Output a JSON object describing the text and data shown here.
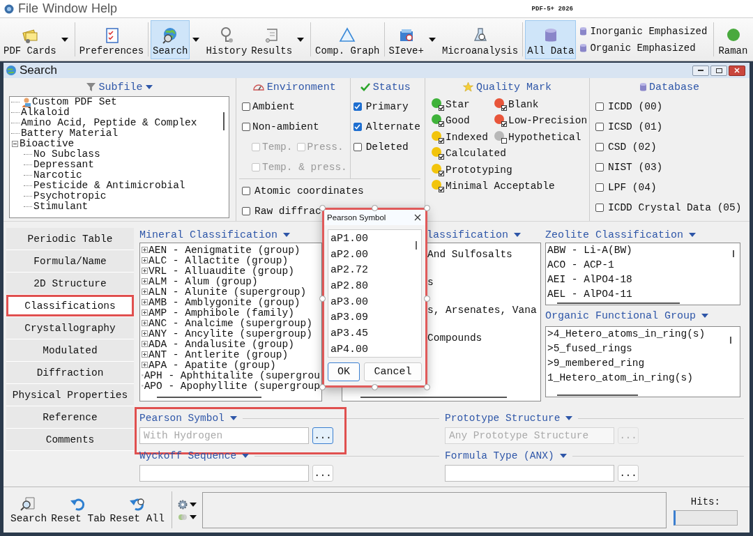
{
  "menu": [
    "File",
    "Window",
    "Help"
  ],
  "app_title": "PDF-5+ 2026",
  "toolbar": [
    {
      "kind": "button",
      "label": "PDF Cards",
      "selected": false,
      "dropdown": true
    },
    {
      "kind": "button",
      "label": "Preferences",
      "selected": false,
      "dropdown": false
    },
    {
      "kind": "button",
      "label": "Search",
      "selected": true,
      "dropdown": true
    },
    {
      "kind": "button",
      "label": "History",
      "selected": false,
      "dropdown": false
    },
    {
      "kind": "button",
      "label": "Results",
      "selected": false,
      "dropdown": true
    },
    {
      "kind": "button",
      "label": "Comp. Graph",
      "selected": false,
      "dropdown": false
    },
    {
      "kind": "button",
      "label": "SIeve+",
      "selected": false,
      "dropdown": true
    },
    {
      "kind": "button",
      "label": "Microanalysis",
      "selected": false,
      "dropdown": false
    },
    {
      "kind": "button",
      "label": "All Data",
      "selected": true,
      "dropdown": false
    },
    {
      "kind": "stack",
      "items": [
        {
          "label": "Inorganic Emphasized"
        },
        {
          "label": "Organic Emphasized"
        }
      ]
    },
    {
      "kind": "button",
      "label": "Raman",
      "selected": false,
      "dropdown": false
    }
  ],
  "window": {
    "title": "Search"
  },
  "subfile": {
    "title": "Subfile",
    "tree": [
      {
        "kind": "custom",
        "label": "Custom PDF Set"
      },
      {
        "kind": "category",
        "label": "Alkaloid"
      },
      {
        "kind": "category",
        "label": "Amino Acid, Peptide & Complex"
      },
      {
        "kind": "category",
        "label": "Battery Material"
      },
      {
        "kind": "category",
        "label": "Bioactive",
        "expanded": true,
        "children": [
          {
            "kind": "category",
            "label": "No Subclass"
          },
          {
            "kind": "category",
            "label": "Depressant"
          },
          {
            "kind": "category",
            "label": "Narcotic"
          },
          {
            "kind": "category",
            "label": "Pesticide & Antimicrobial"
          },
          {
            "kind": "category",
            "label": "Psychotropic"
          },
          {
            "kind": "category",
            "label": "Stimulant"
          }
        ]
      }
    ]
  },
  "environment": {
    "title": "Environment",
    "rows": [
      [
        {
          "label": "Ambient",
          "checked": false,
          "disabled": false
        }
      ],
      [
        {
          "label": "Non-ambient",
          "checked": false,
          "disabled": false
        }
      ],
      [
        {
          "label": "Temp.",
          "checked": false,
          "disabled": true
        },
        {
          "label": "Press.",
          "checked": false,
          "disabled": true
        }
      ],
      [
        {
          "label": "Temp. & press.",
          "checked": false,
          "disabled": true
        }
      ]
    ]
  },
  "status": {
    "title": "Status",
    "options": [
      {
        "label": "Primary",
        "checked": true
      },
      {
        "label": "Alternate",
        "checked": true
      },
      {
        "label": "Deleted",
        "checked": false
      }
    ]
  },
  "extra_options": [
    {
      "label": "Atomic coordinates",
      "checked": false
    },
    {
      "label": "Raw diffrac",
      "checked": false
    }
  ],
  "quality_mark": {
    "title": "Quality Mark",
    "rows": [
      [
        {
          "label": "Star",
          "color": "#3fb23a",
          "checked": true
        },
        {
          "label": "Blank",
          "color": "#e8553a",
          "checked": true
        }
      ],
      [
        {
          "label": "Good",
          "color": "#3fb23a",
          "checked": true
        },
        {
          "label": "Low-Precision",
          "color": "#e8553a",
          "checked": true
        }
      ],
      [
        {
          "label": "Indexed",
          "color": "#f2c40c",
          "checked": true
        },
        {
          "label": "Hypothetical",
          "color": "#b8b8b8",
          "checked": false
        }
      ],
      [
        {
          "label": "Calculated",
          "color": "#f2c40c",
          "checked": true
        }
      ],
      [
        {
          "label": "Prototyping",
          "color": "#f2c40c",
          "checked": true
        }
      ],
      [
        {
          "label": "Minimal Acceptable",
          "color": "#f2c40c",
          "checked": true
        }
      ]
    ]
  },
  "database": {
    "title": "Database",
    "options": [
      {
        "label": "ICDD (00)",
        "checked": false
      },
      {
        "label": "ICSD (01)",
        "checked": false
      },
      {
        "label": "CSD (02)",
        "checked": false
      },
      {
        "label": "NIST (03)",
        "checked": false
      },
      {
        "label": "LPF (04)",
        "checked": false
      },
      {
        "label": "ICDD Crystal Data (05)",
        "checked": false
      }
    ]
  },
  "search_tabs": [
    {
      "label": "Periodic Table",
      "selected": false,
      "highlighted": false
    },
    {
      "label": "Formula/Name",
      "selected": false,
      "highlighted": false
    },
    {
      "label": "2D Structure",
      "selected": false,
      "highlighted": false
    },
    {
      "label": "Classifications",
      "selected": true,
      "highlighted": true
    },
    {
      "label": "Crystallography",
      "selected": false,
      "highlighted": false
    },
    {
      "label": "Modulated",
      "selected": false,
      "highlighted": false
    },
    {
      "label": "Diffraction",
      "selected": false,
      "highlighted": false
    },
    {
      "label": "Physical Properties",
      "selected": false,
      "highlighted": false
    },
    {
      "label": "Reference",
      "selected": false,
      "highlighted": false
    },
    {
      "label": "Comments",
      "selected": false,
      "highlighted": false
    }
  ],
  "mineral_classification": {
    "title": "Mineral Classification",
    "items": [
      "AEN - Aenigmatite (group)",
      "ALC - Allactite (group)",
      "VRL - Alluaudite (group)",
      "ALM - Alum (group)",
      "ALN - Alunite (supergroup)",
      "AMB - Amblygonite (group)",
      "AMP - Amphibole (family)",
      "ANC - Analcime (supergroup)",
      "ANY - Ancylite (supergroup)",
      "ADA - Andalusite (group)",
      "ANT - Antlerite (group)",
      "APA - Apatite (group)",
      "APH - Aphthitalite (supergrou",
      "APO - Apophyllite (supergroup"
    ]
  },
  "covered_classification": {
    "title": "lassification",
    "items": [
      "And Sulfosalts",
      "s",
      "s, Arsenates, Vana",
      "Compounds"
    ]
  },
  "zeolite_classification": {
    "title": "Zeolite Classification",
    "items": [
      "ABW - Li-A(BW)",
      "ACO - ACP-1",
      "AEI - AlPO4-18",
      "AEL - AlPO4-11"
    ]
  },
  "organic_functional_group": {
    "title": "Organic Functional Group",
    "items": [
      ">4_Hetero_atoms_in_ring(s)",
      ">5_fused_rings",
      ">9_membered_ring",
      "1_Hetero_atom_in_ring(s)"
    ]
  },
  "criteria": [
    {
      "title": "Pearson Symbol",
      "placeholder": "With Hydrogen",
      "button": "...",
      "button_focused": true,
      "disabled": false,
      "highlighted": true
    },
    {
      "title": "Prototype Structure",
      "placeholder": "Any Prototype Structure",
      "button": "...",
      "button_focused": false,
      "disabled": true,
      "highlighted": false
    },
    {
      "title": "Wyckoff Sequence",
      "button": "...",
      "button_focused": false,
      "disabled": false,
      "highlighted": false
    },
    {
      "title": "Formula Type (ANX)",
      "button": "...",
      "button_focused": false,
      "disabled": false,
      "highlighted": false
    }
  ],
  "bottom_actions": [
    {
      "label": "Search"
    },
    {
      "label": "Reset Tab"
    },
    {
      "label": "Reset All"
    }
  ],
  "hits": {
    "label": "Hits:"
  },
  "dialog": {
    "title": "Pearson Symbol",
    "items": [
      "aP1.00",
      "aP2.00",
      "aP2.72",
      "aP2.80",
      "aP3.00",
      "aP3.09",
      "aP3.45",
      "aP4.00"
    ],
    "buttons": [
      {
        "label": "OK",
        "focused": true
      },
      {
        "label": "Cancel",
        "focused": false
      }
    ]
  }
}
